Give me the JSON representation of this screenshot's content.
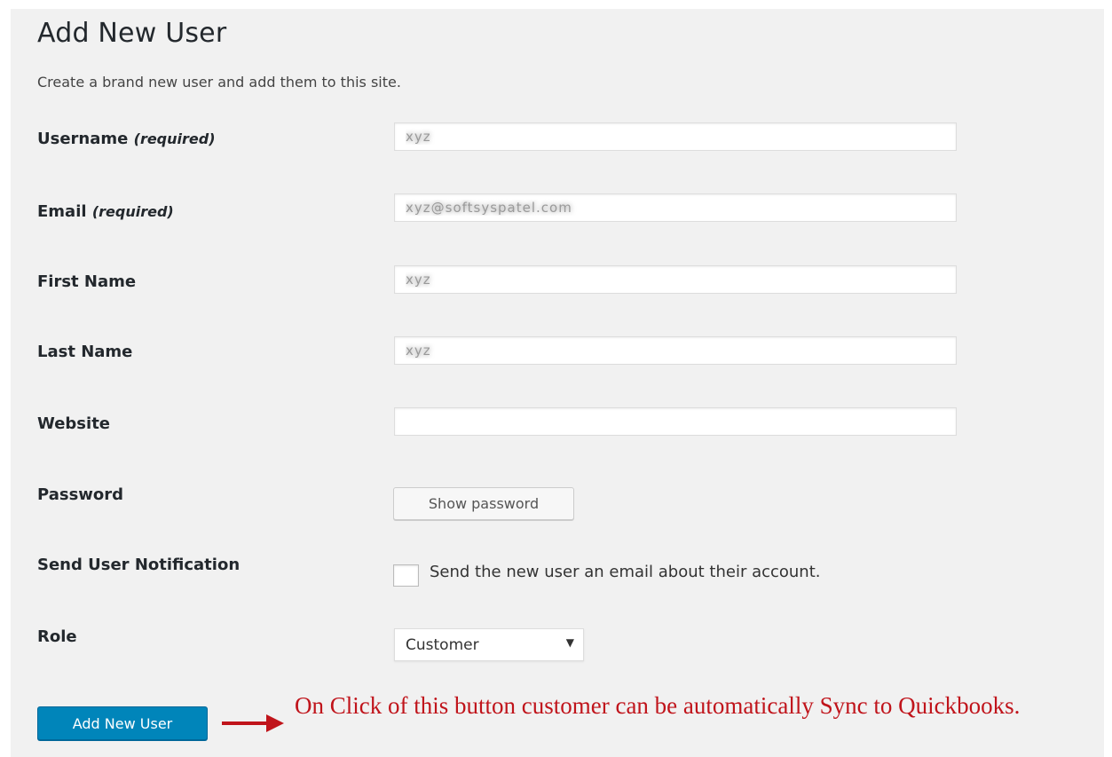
{
  "page": {
    "title": "Add New User",
    "description": "Create a brand new user and add them to this site."
  },
  "form": {
    "username": {
      "label": "Username",
      "required_text": "(required)",
      "value": "xyz"
    },
    "email": {
      "label": "Email",
      "required_text": "(required)",
      "value": "xyz@softsyspatel.com"
    },
    "first_name": {
      "label": "First Name",
      "value": "xyz"
    },
    "last_name": {
      "label": "Last Name",
      "value": "xyz"
    },
    "website": {
      "label": "Website",
      "value": ""
    },
    "password": {
      "label": "Password",
      "button_label": "Show password"
    },
    "notification": {
      "label": "Send User Notification",
      "checkbox_label": "Send the new user an email about their account.",
      "checked": false
    },
    "role": {
      "label": "Role",
      "selected": "Customer",
      "icon": "chevron-down-icon"
    },
    "submit_label": "Add New User"
  },
  "annotation": {
    "text": "On Click of this button customer can be automatically Sync to Quickbooks.",
    "color": "#c0141b",
    "arrow_icon": "right-arrow-icon"
  },
  "colors": {
    "primary_button": "#0085ba",
    "background": "#f1f1f1",
    "annotation": "#c0141b"
  }
}
